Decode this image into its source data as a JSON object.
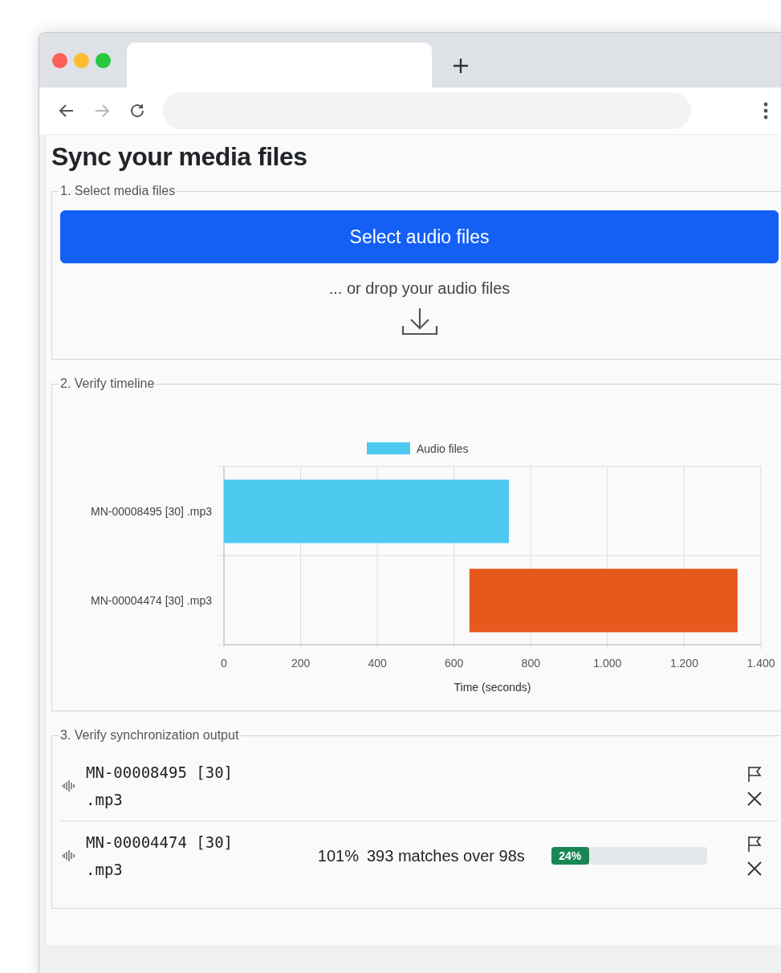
{
  "browser": {
    "forward_disabled": true
  },
  "page": {
    "title": "Sync your media files"
  },
  "step1": {
    "legend": "1. Select media files",
    "button": "Select audio files",
    "drop_hint": "... or drop your audio files"
  },
  "step2": {
    "legend": "2. Verify timeline",
    "chart_data": {
      "type": "bar",
      "orientation": "horizontal",
      "xlabel": "Time (seconds)",
      "categories": [
        "MN-00008495 [30] .mp3",
        "MN-00004474 [30] .mp3"
      ],
      "grid": true,
      "series": [
        {
          "name": "Audio files",
          "color": "#4dc9f0",
          "values": [
            743,
            null
          ]
        },
        {
          "color": "#e6581c",
          "base": [
            null,
            640
          ],
          "values": [
            null,
            699
          ]
        }
      ],
      "xlim": [
        0,
        1400
      ],
      "xticks": [
        {
          "value": 0,
          "label": "0"
        },
        {
          "value": 200,
          "label": "200"
        },
        {
          "value": 400,
          "label": "400"
        },
        {
          "value": 600,
          "label": "600"
        },
        {
          "value": 800,
          "label": "800"
        },
        {
          "value": 1000,
          "label": "1.000"
        },
        {
          "value": 1200,
          "label": "1.200"
        },
        {
          "value": 1400,
          "label": "1.400"
        }
      ]
    }
  },
  "step3": {
    "legend": "3. Verify synchronization output",
    "files": [
      {
        "name": "MN-00008495 [30] .mp3"
      },
      {
        "name": "MN-00004474 [30] .mp3",
        "percent": "101%",
        "matches": "393 matches over 98s",
        "progress": {
          "label": "24%",
          "level": 0.24
        }
      }
    ]
  }
}
